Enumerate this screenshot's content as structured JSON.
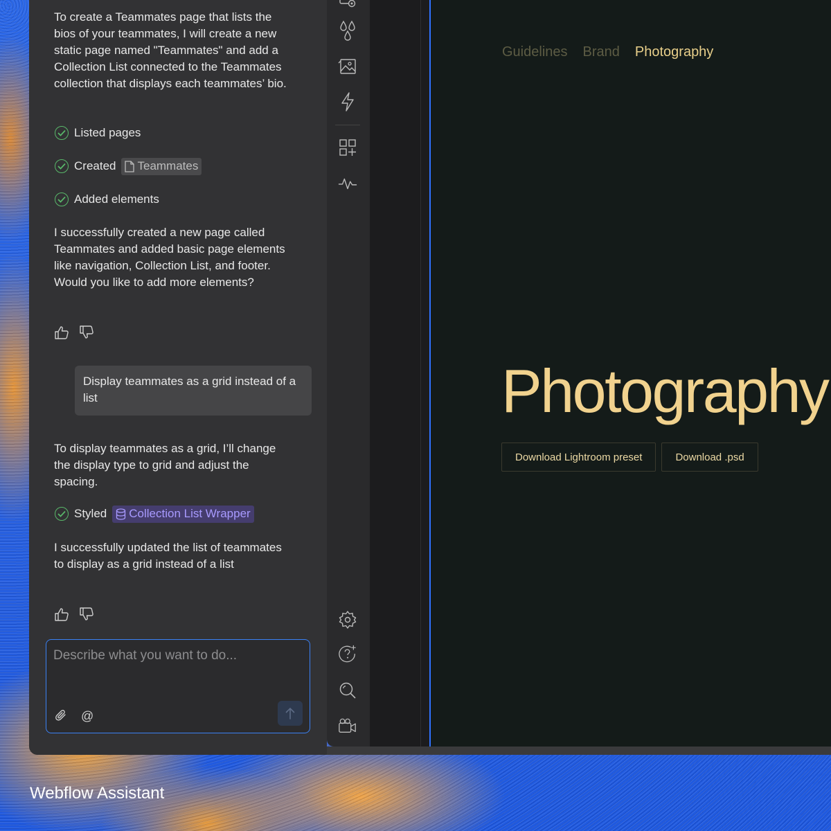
{
  "assistant": {
    "intro": "To create a Teammates page that lists the bios of your teammates, I will create a new static page named \"Teammates\" and add a Collection List connected to the Teammates collection that displays each teammates’ bio.",
    "steps": [
      {
        "label": "Listed pages"
      },
      {
        "label": "Created",
        "chip": "Teammates"
      },
      {
        "label": "Added elements"
      }
    ],
    "result1": "I successfully created a new page called Teammates and added basic page elements like navigation, Collection List, and footer. Would you like to add more elements?",
    "user_message": "Display teammates as a grid instead of a list",
    "reply2": "To display teammates as a grid, I’ll change the display type to grid and adjust the spacing.",
    "step2": {
      "label": "Styled",
      "chip": "Collection List Wrapper"
    },
    "result2": "I successfully updated the list of teammates to display as a grid instead of a list",
    "input_placeholder": "Describe what you want to do...",
    "mention_symbol": "@"
  },
  "rail_icons": [
    "interactions-icon",
    "color-drops-icon",
    "assets-image-icon",
    "lightning-icon",
    "apps-icon",
    "activity-icon",
    "settings-gear-icon",
    "ai-help-icon",
    "search-icon",
    "video-tutorials-icon"
  ],
  "canvas": {
    "nav": [
      "Guidelines",
      "Brand",
      "Photography"
    ],
    "active_nav": "Photography",
    "hero_title": "Photography",
    "buttons": [
      "Download Lightroom preset",
      "Download .psd"
    ]
  },
  "caption": "Webflow Assistant",
  "colors": {
    "panel": "#323234",
    "accent_blue": "#3b82f6",
    "success": "#59b86a",
    "gold": "#f1d28e",
    "collection_chip": "#a89aff"
  }
}
